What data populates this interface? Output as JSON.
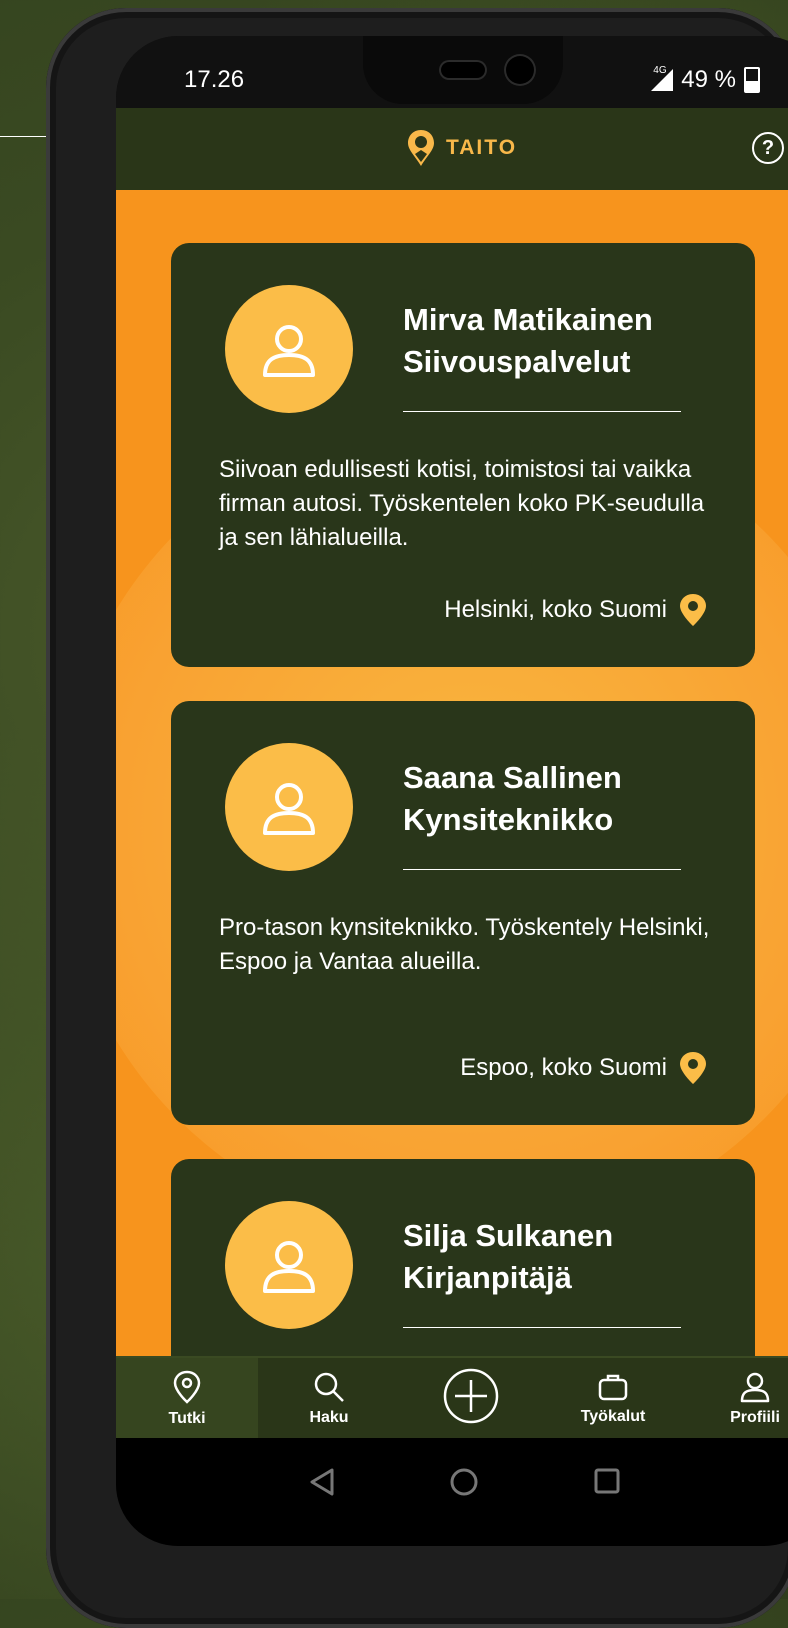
{
  "status_bar": {
    "time": "17.26",
    "network": "4G",
    "battery": "49 %"
  },
  "app_bar": {
    "logo_text": "TAITO",
    "help_icon": "help-circle-icon"
  },
  "cards": [
    {
      "name": "Mirva Matikainen",
      "profession": "Siivouspalvelut",
      "description": "Siivoan edullisesti kotisi, toimistosi tai vaikka firman autosi. Työskentelen koko PK-seudulla ja sen lähialueilla.",
      "location": "Helsinki, koko Suomi"
    },
    {
      "name": "Saana Sallinen",
      "profession": "Kynsiteknikko",
      "description": "Pro-tason kynsiteknikko. Työskentely Helsinki, Espoo ja Vantaa alueilla.",
      "location": "Espoo, koko Suomi"
    },
    {
      "name": "Silja Sulkanen",
      "profession": "Kirjanpitäjä",
      "description": "",
      "location": ""
    }
  ],
  "nav": {
    "items": [
      {
        "label": "Tutki",
        "icon": "map-pin-icon",
        "active": true
      },
      {
        "label": "Haku",
        "icon": "search-icon"
      },
      {
        "label": "",
        "icon": "add-icon"
      },
      {
        "label": "Työkalut",
        "icon": "briefcase-icon"
      },
      {
        "label": "Profiili",
        "icon": "user-icon"
      }
    ]
  },
  "colors": {
    "primary_dark": "#29361a",
    "accent_orange": "#f7941d",
    "accent_yellow": "#fbbd48"
  }
}
